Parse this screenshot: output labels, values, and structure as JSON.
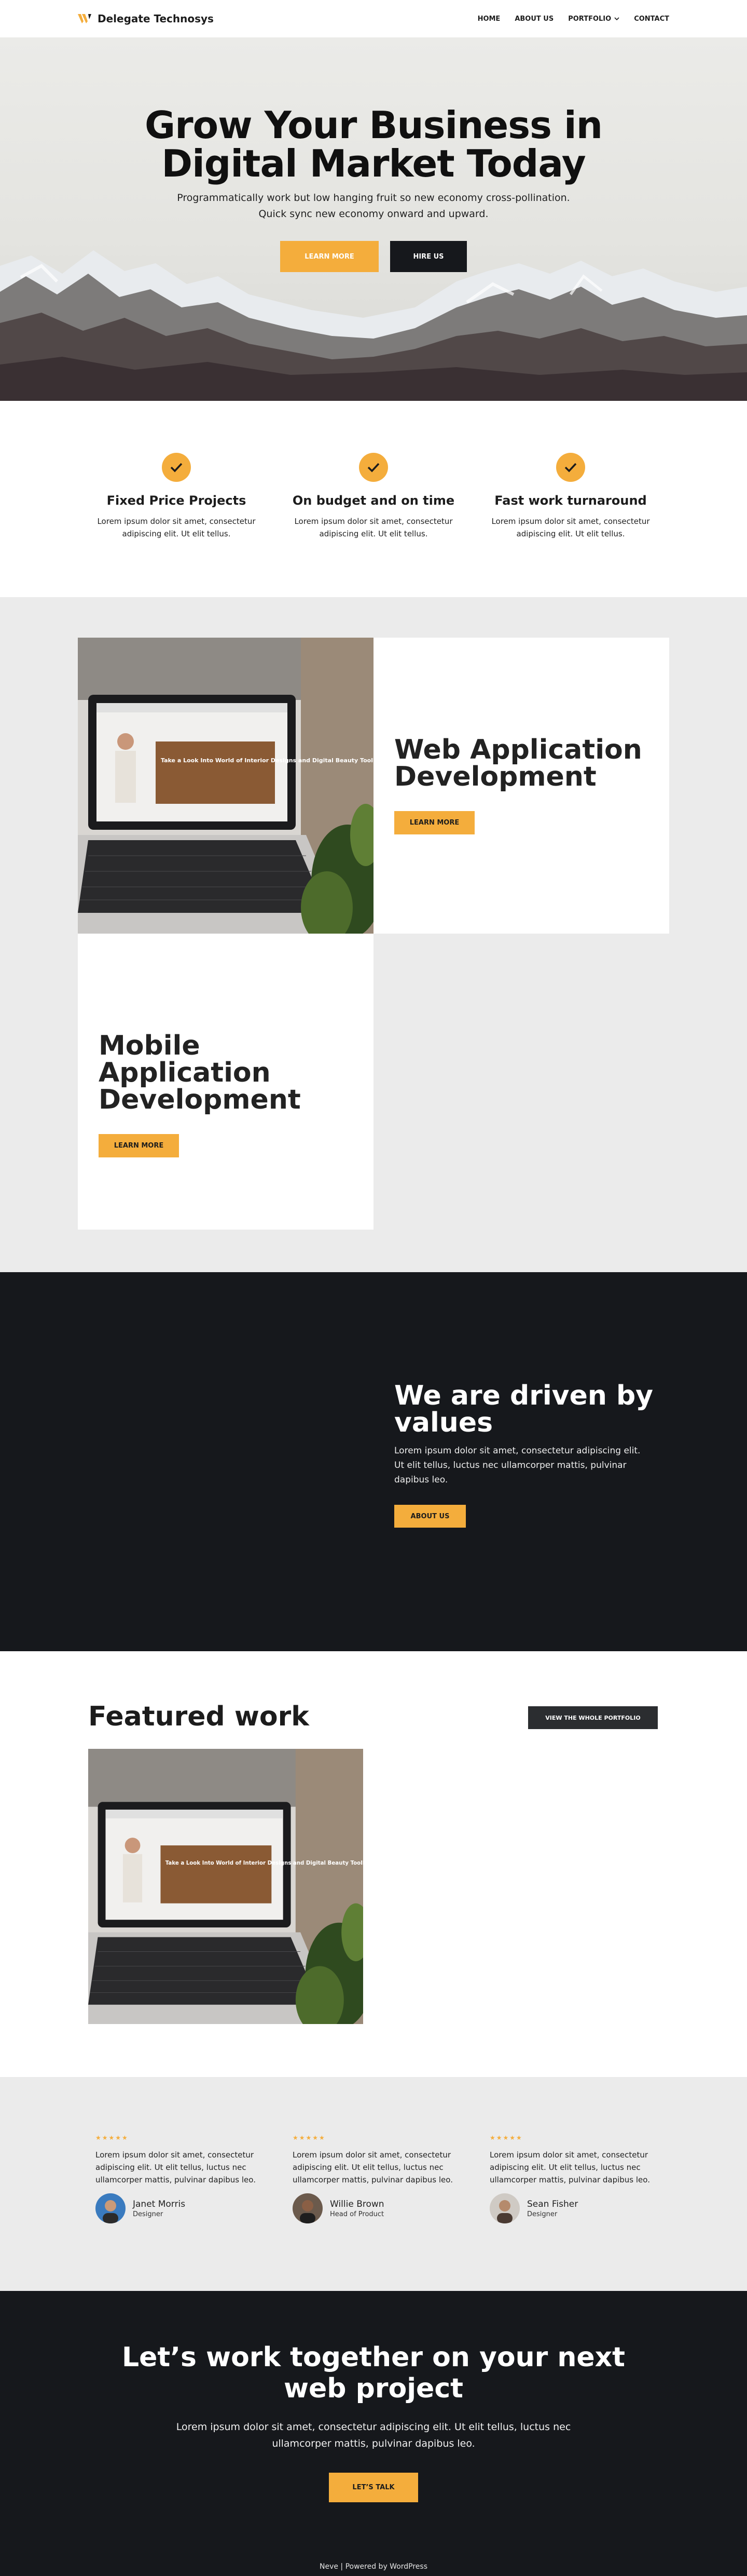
{
  "header": {
    "brand": "Delegate Technosys",
    "nav": [
      "HOME",
      "ABOUT US",
      "PORTFOLIO",
      "CONTACT"
    ]
  },
  "hero": {
    "title_line1": "Grow Your Business in",
    "title_line2": "Digital Market Today",
    "subtitle_line1": "Programmatically work but low hanging fruit so new economy cross-pollination.",
    "subtitle_line2": "Quick sync new economy onward and upward.",
    "btn_primary": "LEARN MORE",
    "btn_secondary": "HIRE US"
  },
  "features": [
    {
      "title": "Fixed Price Projects",
      "text_line1": "Lorem ipsum dolor sit amet, consectetur",
      "text_line2": "adipiscing elit. Ut elit tellus."
    },
    {
      "title": "On budget and on time",
      "text_line1": "Lorem ipsum dolor sit amet, consectetur",
      "text_line2": "adipiscing elit. Ut elit tellus."
    },
    {
      "title": "Fast work turnaround",
      "text_line1": "Lorem ipsum dolor sit amet, consectetur",
      "text_line2": "adipiscing elit. Ut elit tellus."
    }
  ],
  "services": {
    "web": {
      "title_line1": "Web Application",
      "title_line2": "Development",
      "btn": "LEARN MORE"
    },
    "mobile": {
      "title_line1": "Mobile Application",
      "title_line2": "Development",
      "btn": "LEARN MORE"
    },
    "screen_text": "Take a Look Into World of Interior Designs and Digital Beauty Toolkit"
  },
  "values": {
    "title_line1": "We are driven by",
    "title_line2": "values",
    "text_line1": "Lorem ipsum dolor sit amet, consectetur adipiscing elit.",
    "text_line2": "Ut elit tellus, luctus nec ullamcorper mattis, pulvinar",
    "text_line3": "dapibus leo.",
    "btn": "ABOUT US"
  },
  "featured": {
    "title": "Featured work",
    "btn": "VIEW THE WHOLE PORTFOLIO"
  },
  "testimonials": [
    {
      "stars": "★★★★★",
      "l1": "Lorem ipsum dolor sit amet, consectetur",
      "l2": "adipiscing elit. Ut elit tellus, luctus nec",
      "l3": "ullamcorper mattis, pulvinar dapibus leo.",
      "name": "Janet Morris",
      "role": "Designer"
    },
    {
      "stars": "★★★★★",
      "l1": "Lorem ipsum dolor sit amet, consectetur",
      "l2": "adipiscing elit. Ut elit tellus, luctus nec",
      "l3": "ullamcorper mattis, pulvinar dapibus leo.",
      "name": "Willie Brown",
      "role": "Head of Product"
    },
    {
      "stars": "★★★★★",
      "l1": "Lorem ipsum dolor sit amet, consectetur",
      "l2": "adipiscing elit. Ut elit tellus, luctus nec",
      "l3": "ullamcorper mattis, pulvinar dapibus leo.",
      "name": "Sean Fisher",
      "role": "Designer"
    }
  ],
  "cta": {
    "title_line1": "Let’s work together on your next",
    "title_line2": "web project",
    "text_line1": "Lorem ipsum dolor sit amet, consectetur adipiscing elit. Ut elit tellus, luctus nec",
    "text_line2": "ullamcorper mattis, pulvinar dapibus leo.",
    "btn": "LET’S TALK"
  },
  "footer": {
    "text": "Neve | Powered by WordPress"
  },
  "colors": {
    "accent": "#f4ad3c",
    "dark": "#16181c",
    "light_bg": "#ebebeb"
  }
}
